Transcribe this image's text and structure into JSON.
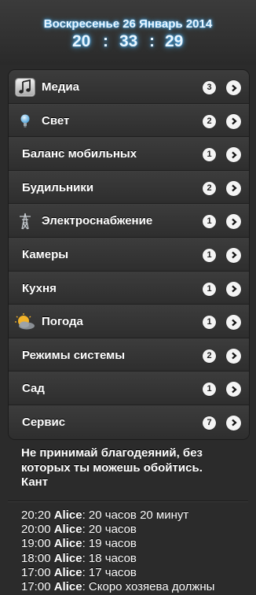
{
  "header": {
    "date": "Воскресенье 26 Январь 2014",
    "clock": {
      "hours": "20",
      "minutes": "33",
      "seconds": "29",
      "separator": ":"
    }
  },
  "menu": {
    "items": [
      {
        "label": "Медиа",
        "count": "3",
        "icon": "music-note-icon"
      },
      {
        "label": "Свет",
        "count": "2",
        "icon": "light-bulb-icon"
      },
      {
        "label": "Баланс мобильных",
        "count": "1"
      },
      {
        "label": "Будильники",
        "count": "2"
      },
      {
        "label": "Электроснабжение",
        "count": "1",
        "icon": "power-pylon-icon"
      },
      {
        "label": "Камеры",
        "count": "1"
      },
      {
        "label": "Кухня",
        "count": "1"
      },
      {
        "label": "Погода",
        "count": "1",
        "icon": "weather-sun-cloud-icon"
      },
      {
        "label": "Режимы системы",
        "count": "2"
      },
      {
        "label": "Сад",
        "count": "1"
      },
      {
        "label": "Сервис",
        "count": "7"
      }
    ]
  },
  "quote": {
    "text": "Не принимай благодеяний, без которых ты можешь обойтись.",
    "author": "Кант"
  },
  "log": {
    "entries": [
      {
        "time": "20:20",
        "who": "Alice",
        "msg": ": 20 часов 20 минут"
      },
      {
        "time": "20:00",
        "who": "Alice",
        "msg": ": 20 часов"
      },
      {
        "time": "19:00",
        "who": "Alice",
        "msg": ": 19 часов"
      },
      {
        "time": "18:00",
        "who": "Alice",
        "msg": ": 18 часов"
      },
      {
        "time": "17:00",
        "who": "Alice",
        "msg": ": 17 часов"
      },
      {
        "time": "17:00",
        "who": "Alice",
        "msg": ": Скоро хозяева должны"
      }
    ]
  },
  "colors": {
    "glow": "#4fb8ff",
    "background": "#2b2b2b",
    "badge": "#f4f4f4"
  }
}
